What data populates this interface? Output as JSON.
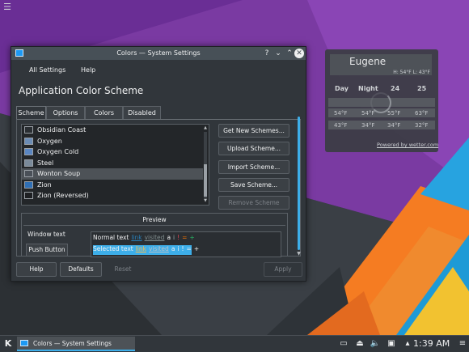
{
  "colors": {
    "accent": "#3daee9",
    "window_bg": "#31363b",
    "titlebar_bg": "#475057",
    "panel_bg": "#31363b",
    "wallpaper_purple": "#6a2e8c"
  },
  "desktop": {
    "corner_icon": "hamburger-icon",
    "weather": {
      "city": "Eugene",
      "high_low": "H: 54°F L: 43°F",
      "headers": [
        "Day",
        "Night",
        "24",
        "25"
      ],
      "highs": [
        "54°F",
        "54°F",
        "55°F",
        "63°F"
      ],
      "lows": [
        "43°F",
        "34°F",
        "34°F",
        "32°F"
      ],
      "powered_by": "Powered by wetter.com"
    }
  },
  "window": {
    "title": "Colors — System Settings",
    "title_icon": "colors-app-icon",
    "titlebar_buttons": {
      "help": "?",
      "minimize": "⌄",
      "maximize": "⌃",
      "close": "✕"
    },
    "menu": [
      "All Settings",
      "Help"
    ],
    "page_title": "Application Color Scheme",
    "tabs": [
      "Scheme",
      "Options",
      "Colors",
      "Disabled"
    ],
    "active_tab": "Scheme",
    "schemes": [
      {
        "name": "Obsidian Coast",
        "swatch": "#2a2e32"
      },
      {
        "name": "Oxygen",
        "swatch": "#6b8cb5"
      },
      {
        "name": "Oxygen Cold",
        "swatch": "#5a86c2"
      },
      {
        "name": "Steel",
        "swatch": "#7a8a9a"
      },
      {
        "name": "Wonton Soup",
        "swatch": "#4a5058"
      },
      {
        "name": "Zion",
        "swatch": "#2f6fb5"
      },
      {
        "name": "Zion (Reversed)",
        "swatch": "#1d1f22"
      }
    ],
    "selected_scheme": "Wonton Soup",
    "side_buttons": {
      "get_new": "Get New Schemes...",
      "upload": "Upload Scheme...",
      "import": "Import Scheme...",
      "save": "Save Scheme...",
      "remove": "Remove Scheme"
    },
    "preview": {
      "title": "Preview",
      "window_text": "Window text",
      "push_button": "Push Button",
      "normal_text": "Normal text",
      "selected_text": "Selected text",
      "link": "link",
      "visited": "visited",
      "symbols": [
        "a",
        "i",
        "!",
        "=",
        "+"
      ]
    },
    "bottom_buttons": {
      "help": "Help",
      "defaults": "Defaults",
      "reset": "Reset",
      "apply": "Apply"
    }
  },
  "taskbar": {
    "launcher_icon": "kde-launcher-icon",
    "task_title": "Colors — System Settings",
    "tray_icons": [
      "battery-icon",
      "usb-device-icon",
      "volume-icon",
      "network-icon",
      "tray-expand-icon"
    ],
    "clock": "1:39 AM",
    "menu_icon": "panel-menu-icon"
  }
}
